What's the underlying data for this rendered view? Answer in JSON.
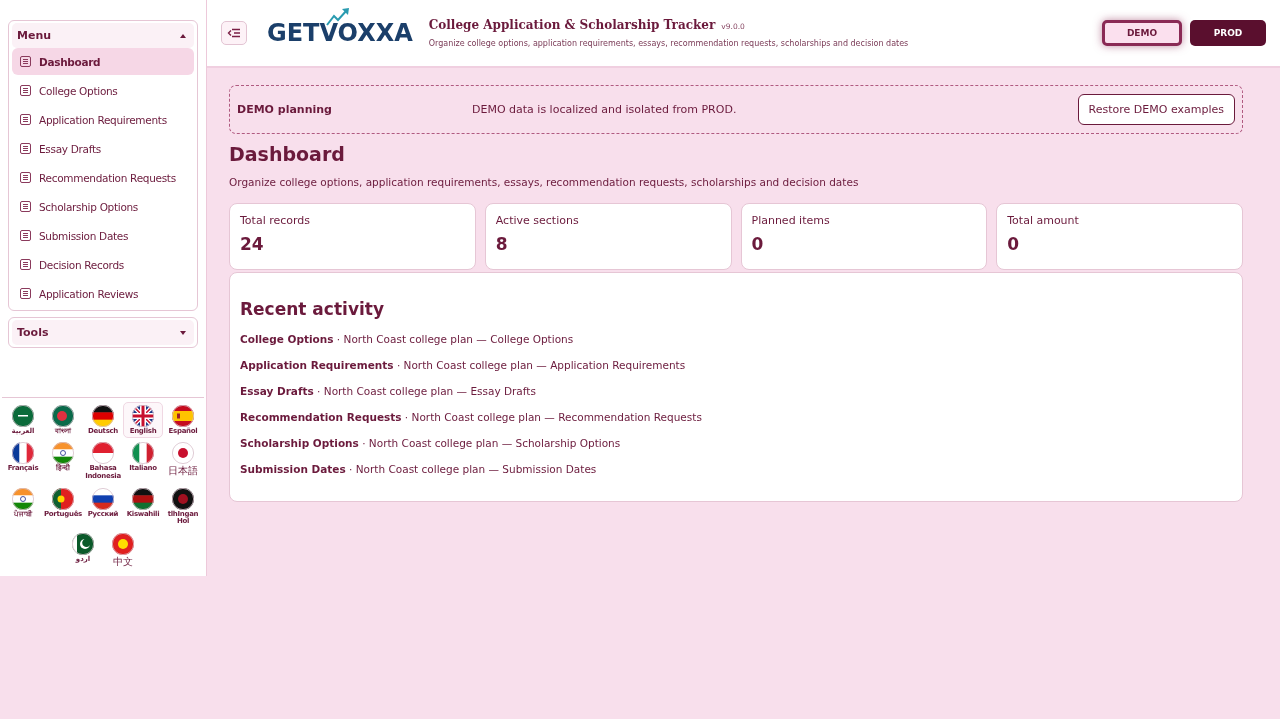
{
  "sidebar": {
    "menu": {
      "title": "Menu",
      "expanded": true,
      "items": [
        {
          "label": "Dashboard",
          "selected": true
        },
        {
          "label": "College Options",
          "selected": false
        },
        {
          "label": "Application Requirements",
          "selected": false
        },
        {
          "label": "Essay Drafts",
          "selected": false
        },
        {
          "label": "Recommendation Requests",
          "selected": false
        },
        {
          "label": "Scholarship Options",
          "selected": false
        },
        {
          "label": "Submission Dates",
          "selected": false
        },
        {
          "label": "Decision Records",
          "selected": false
        },
        {
          "label": "Application Reviews",
          "selected": false
        }
      ]
    },
    "tools": {
      "title": "Tools",
      "expanded": false
    },
    "languages": [
      {
        "label": "العربية",
        "selected": false
      },
      {
        "label": "বাংলা",
        "selected": false
      },
      {
        "label": "Deutsch",
        "selected": false
      },
      {
        "label": "English",
        "selected": true
      },
      {
        "label": "Español",
        "selected": false
      },
      {
        "label": "Français",
        "selected": false
      },
      {
        "label": "हिन्दी",
        "selected": false
      },
      {
        "label": "Bahasa Indonesia",
        "selected": false
      },
      {
        "label": "Italiano",
        "selected": false
      },
      {
        "label": "日本語",
        "selected": false
      },
      {
        "label": "ਪੰਜਾਬੀ",
        "selected": false
      },
      {
        "label": "Português",
        "selected": false
      },
      {
        "label": "Русский",
        "selected": false
      },
      {
        "label": "Kiswahili",
        "selected": false
      },
      {
        "label": "tlhIngan Hol",
        "selected": false
      },
      {
        "label": "اردو",
        "selected": false
      },
      {
        "label": "中文",
        "selected": false
      }
    ]
  },
  "header": {
    "logo": "GETVOXXA",
    "title": "College Application & Scholarship Tracker",
    "version": "v9.0.0",
    "subtitle": "Organize college options, application requirements, essays, recommendation requests, scholarships and decision dates",
    "modes": [
      {
        "label": "DEMO",
        "selected": true
      },
      {
        "label": "PROD",
        "selected": false
      }
    ]
  },
  "banner": {
    "title": "DEMO planning",
    "message": "DEMO data is localized and isolated from PROD.",
    "button": "Restore DEMO examples"
  },
  "page": {
    "title": "Dashboard",
    "subtitle": "Organize college options, application requirements, essays, recommendation requests, scholarships and decision dates"
  },
  "stats": [
    {
      "label": "Total records",
      "value": "24"
    },
    {
      "label": "Active sections",
      "value": "8"
    },
    {
      "label": "Planned items",
      "value": "0"
    },
    {
      "label": "Total amount",
      "value": "0"
    }
  ],
  "activity": {
    "title": "Recent activity",
    "items": [
      {
        "section": "College Options",
        "detail": "· North Coast college plan — College Options"
      },
      {
        "section": "Application Requirements",
        "detail": "· North Coast college plan — Application Requirements"
      },
      {
        "section": "Essay Drafts",
        "detail": "· North Coast college plan — Essay Drafts"
      },
      {
        "section": "Recommendation Requests",
        "detail": "· North Coast college plan — Recommendation Requests"
      },
      {
        "section": "Scholarship Options",
        "detail": "· North Coast college plan — Scholarship Options"
      },
      {
        "section": "Submission Dates",
        "detail": "· North Coast college plan — Submission Dates"
      }
    ]
  }
}
